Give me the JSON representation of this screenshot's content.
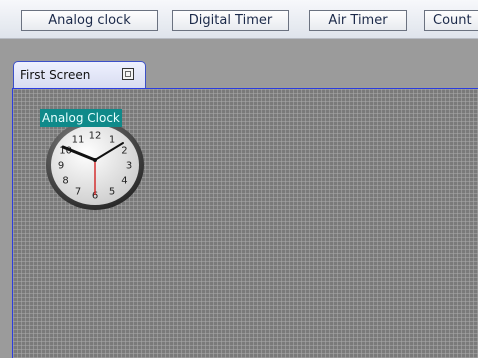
{
  "toolbar": {
    "buttons": [
      {
        "label": "Analog clock"
      },
      {
        "label": "Digital Timer"
      },
      {
        "label": "Air Timer"
      },
      {
        "label": "Count"
      }
    ]
  },
  "tabs": [
    {
      "label": "First Screen"
    }
  ],
  "widget": {
    "title": "Analog Clock",
    "numbers": [
      "12",
      "1",
      "2",
      "3",
      "4",
      "5",
      "6",
      "7",
      "8",
      "9",
      "10",
      "11"
    ]
  },
  "colors": {
    "canvas_border": "#2b3ce0",
    "widget_title_bg": "#0f8a8a",
    "second_hand": "#d22222"
  }
}
